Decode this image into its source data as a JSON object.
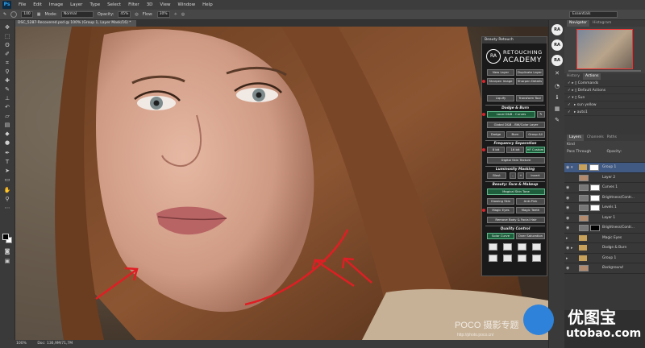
{
  "menubar": {
    "logo": "Ps",
    "items": [
      "File",
      "Edit",
      "Image",
      "Layer",
      "Type",
      "Select",
      "Filter",
      "3D",
      "View",
      "Window",
      "Help"
    ]
  },
  "options": {
    "size": "100",
    "mode_label": "Mode:",
    "mode_value": "Normal",
    "opacity_label": "Opacity:",
    "opacity_value": "45%",
    "flow_label": "Flow:",
    "flow_value": "30%",
    "workspace": "Essentials"
  },
  "document": {
    "tab_title": "DSC_5287-Recovered.psd @ 100% (Group 1, Layer Mask/16) *"
  },
  "status": {
    "zoom": "100%",
    "doc": "Doc: 136,9M/71,7M"
  },
  "dock": {
    "btn_ra1": "RA",
    "btn_ra2": "RA",
    "btn_ra3": "RA"
  },
  "navigator": {
    "tabs": [
      "Navigator",
      "Histogram"
    ]
  },
  "actions": {
    "tabs": [
      "History",
      "Actions"
    ],
    "rows": [
      "Commands",
      "Default Actions",
      "Sun",
      "sun yellow",
      "auto1"
    ]
  },
  "layers": {
    "tabs": [
      "Layers",
      "Channels",
      "Paths"
    ],
    "kind_label": "Kind",
    "blend_mode": "Pass Through",
    "opacity_label": "Opacity:",
    "rows": [
      {
        "name": "Group 1",
        "type": "group",
        "selected": true
      },
      {
        "name": "Layer 2",
        "type": "layer",
        "selected": false
      },
      {
        "name": "Curves 1",
        "type": "adj",
        "selected": false
      },
      {
        "name": "Brightness/Contr...",
        "type": "adj",
        "selected": false
      },
      {
        "name": "Levels 1",
        "type": "adj",
        "selected": false
      },
      {
        "name": "Layer 1",
        "type": "layer",
        "selected": false
      },
      {
        "name": "Brightness/Contr...",
        "type": "adj-dark",
        "selected": false
      },
      {
        "name": "Magic Eyes",
        "type": "group",
        "selected": false
      },
      {
        "name": "Dodge & Burn",
        "type": "group",
        "selected": false
      },
      {
        "name": "Group 1",
        "type": "group",
        "selected": false
      },
      {
        "name": "Background",
        "type": "layer",
        "selected": false
      }
    ]
  },
  "beauty_retouch": {
    "panel_title": "Beauty Retouch",
    "logo_mark": "RA",
    "logo_line1": "RETOUCHING",
    "logo_line2": "ACADEMY",
    "buttons": {
      "new_layer": "New Layer",
      "duplicate_layer": "Duplicate Layer",
      "sharpen_image": "Sharpen Image",
      "sharpen_details": "Sharpen Details",
      "liquify": "Liquify",
      "transform_tool": "Transform Tool",
      "local_dnb_curves": "Local D&B - Curves",
      "global_dnb": "Global D&B - BW/Color Layer",
      "dodge": "Dodge",
      "burn": "Burn",
      "group_all": "Group All",
      "eight_bit": "8 bit",
      "sixteen_bit": "16 bit",
      "hf_custom": "HF Custom",
      "digital_skin_texture": "Digital Skin Texture",
      "blast": "Blast",
      "invert": "Invert",
      "magical_skin_tone": "Magical Skin Tone",
      "glowing_skin": "Glowing Skin",
      "anti_pink": "Anti-Pink",
      "magic_eyes": "Magic Eyes",
      "magic_teeth": "Magic Teeth",
      "remove_body_facial_hair": "Remove Body & Facial Hair",
      "solar_curve": "Solar Curve",
      "over_saturation": "Over Saturation"
    },
    "sections": {
      "dodge_burn": "Dodge & Burn",
      "frequency_separation": "Frequency Separation",
      "luminosity_masking": "Luminosity Masking",
      "beauty_face_makeup": "Beauty: Face & Makeup",
      "quality_control": "Quality Control"
    }
  },
  "canvas_watermark": {
    "poco": "POCO 摄影专题",
    "poco_url": "http://photo.poco.cn/"
  },
  "site_watermark": {
    "title": "优图宝",
    "domain": "utobao.com"
  },
  "colors": {
    "accent_red": "#d8232a",
    "br_green": "#1e5e3c",
    "selected_layer": "#415a84"
  }
}
